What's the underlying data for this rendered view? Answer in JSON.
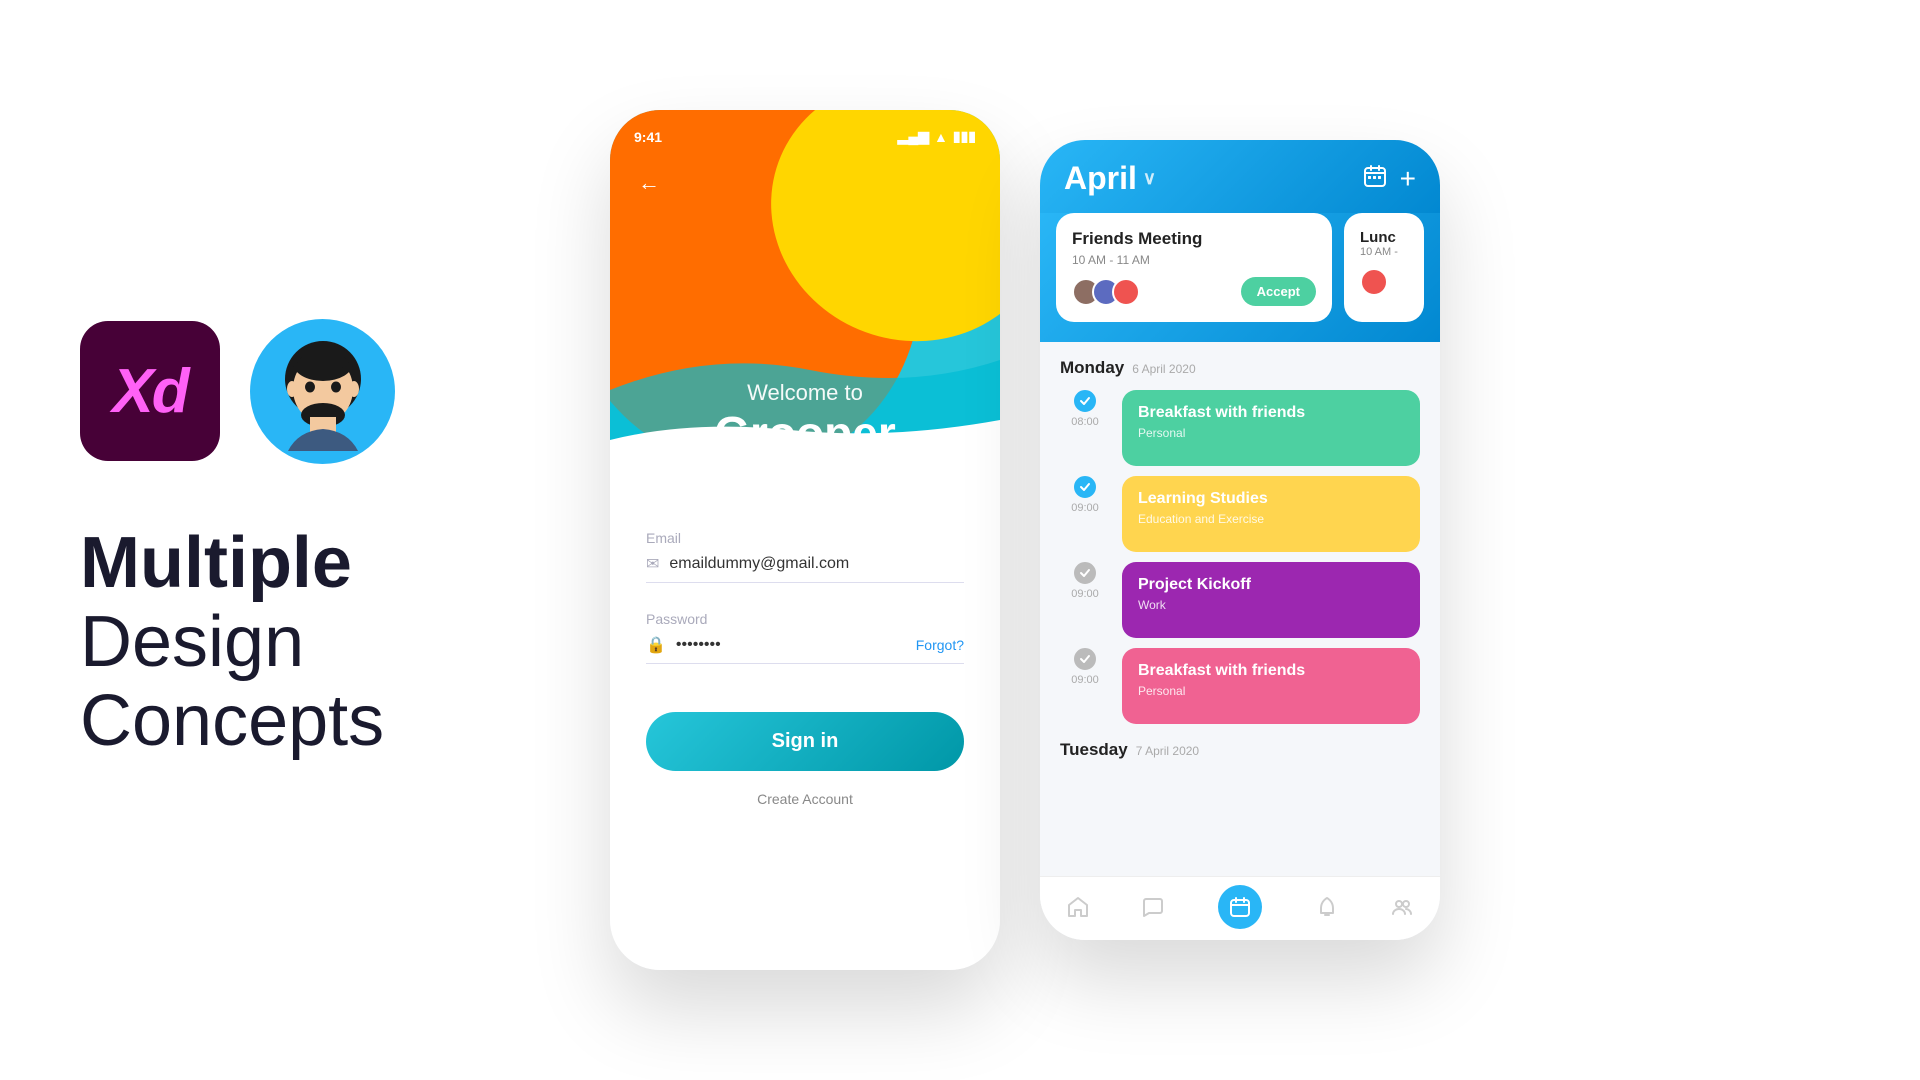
{
  "left": {
    "headline_bold": "Multiple",
    "headline_light1": "Design",
    "headline_light2": "Concepts",
    "xd_label": "Xd"
  },
  "login_phone": {
    "status_time": "9:41",
    "welcome_to": "Welcome to",
    "app_name": "Grooper",
    "email_label": "Email",
    "email_value": "emaildummy@gmail.com",
    "password_label": "Password",
    "password_value": "••••••••",
    "forgot_label": "Forgot?",
    "signin_label": "Sign in",
    "create_account_label": "Create Account"
  },
  "calendar_phone": {
    "month_title": "April",
    "calendar_icon": "📅",
    "add_icon": "+",
    "meeting_card1": {
      "title": "Friends Meeting",
      "time": "10 AM - 11 AM",
      "accept_label": "Accept"
    },
    "meeting_card2": {
      "title": "Lunc",
      "time": "10 AM -"
    },
    "monday": {
      "day": "Monday",
      "date": "6 April 2020",
      "events": [
        {
          "time": "08:00",
          "title": "Breakfast with friends",
          "subtitle": "Personal",
          "color": "green"
        },
        {
          "time": "09:00",
          "title": "Learning Studies",
          "subtitle": "Education and Exercise",
          "color": "yellow"
        },
        {
          "time": "09:00",
          "title": "Project Kickoff",
          "subtitle": "Work",
          "color": "purple"
        },
        {
          "time": "09:00",
          "title": "Breakfast with friends",
          "subtitle": "Personal",
          "color": "pink"
        }
      ]
    },
    "tuesday": {
      "day": "Tuesday",
      "date": "7 April 2020"
    },
    "nav": {
      "home": "🏠",
      "chat": "💬",
      "calendar": "📅",
      "bell": "🔔",
      "group": "👥"
    }
  }
}
